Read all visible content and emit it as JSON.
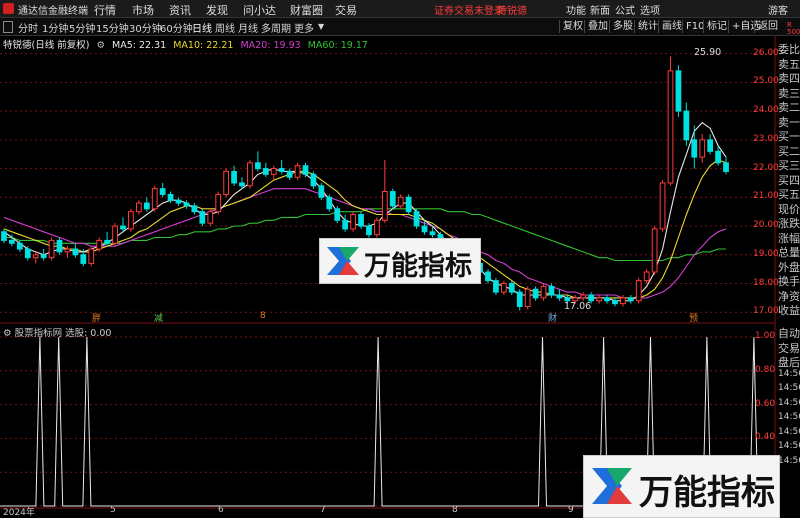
{
  "app": {
    "title": "通达信金融终端",
    "menus": [
      "行情",
      "市场",
      "资讯",
      "发现",
      "问小达",
      "财富圈",
      "交易"
    ],
    "login_status": "证券交易未登录",
    "user": "特锐德",
    "right_menus": [
      "功能",
      "新面",
      "公式",
      "选项"
    ],
    "guest": "游客"
  },
  "toolbar": {
    "periods": [
      "分时",
      "1分钟",
      "5分钟",
      "15分钟",
      "30分钟",
      "60分钟",
      "日线",
      "周线",
      "月线",
      "多周期",
      "更多"
    ],
    "active_period": "日线",
    "buttons": [
      "复权",
      "叠加",
      "多股",
      "统计",
      "画线",
      "F10",
      "标记",
      "+自选",
      "返回"
    ]
  },
  "chart_header": {
    "stock_name": "特锐德(日线 前复权)",
    "ma": [
      {
        "label": "MA5: 22.31",
        "color": "#e8e8e8"
      },
      {
        "label": "MA10: 22.21",
        "color": "#e8d830"
      },
      {
        "label": "MA20: 19.93",
        "color": "#d040d0"
      },
      {
        "label": "MA60: 19.17",
        "color": "#30c030"
      }
    ]
  },
  "price_axis": {
    "ticks": [
      "26.00",
      "25.00",
      "24.00",
      "23.00",
      "22.00",
      "21.00",
      "20.00",
      "19.00",
      "18.00",
      "17.00"
    ],
    "high_label": "25.90",
    "low_label": "17.06",
    "top_label": "R\n500"
  },
  "sub_axis": {
    "ticks": [
      "1.00",
      "0.80",
      "0.60",
      "0.40",
      "0.20",
      "0.00"
    ]
  },
  "indicator": {
    "legend": "股票指标网  选股: 0.00"
  },
  "time_axis": {
    "labels": [
      "2024年",
      "5",
      "6",
      "7",
      "8",
      "9"
    ]
  },
  "markers": [
    {
      "text": "胖",
      "color": "#e07a20"
    },
    {
      "text": "减",
      "color": "#58c858"
    },
    {
      "text": "8",
      "color": "#e07a20"
    },
    {
      "text": "财",
      "color": "#7aa8e8"
    },
    {
      "text": "预",
      "color": "#e07a20"
    }
  ],
  "right_panel": {
    "labels": [
      "委比",
      "卖五",
      "卖四",
      "卖三",
      "卖二",
      "卖一",
      "买一",
      "买二",
      "买三",
      "买四",
      "买五",
      "现价",
      "涨跌",
      "涨幅",
      "总量",
      "外盘",
      "换手",
      "净资",
      "收益",
      "自动",
      "交易",
      "盘后",
      "14:56",
      "14:56",
      "14:56",
      "14:56",
      "14:56",
      "14:56",
      "14:56"
    ]
  },
  "watermark": {
    "text": "万能指标",
    "colors": {
      "blue": "#1e6fd9",
      "green": "#17a86b",
      "red": "#e23b3b"
    }
  },
  "colors": {
    "up": "#ff3b3b",
    "down": "#00e0e0",
    "grid": "#7a1010",
    "ma5": "#e8e8e8",
    "ma10": "#e8d830",
    "ma20": "#d040d0",
    "ma60": "#30c030",
    "indicator": "#e8e8e8"
  },
  "chart_data": {
    "type": "candlestick",
    "ylim": [
      16.8,
      26.3
    ],
    "candles_ohlc": [
      [
        19.8,
        19.9,
        19.4,
        19.5
      ],
      [
        19.5,
        19.7,
        19.3,
        19.4
      ],
      [
        19.4,
        19.5,
        19.1,
        19.2
      ],
      [
        19.2,
        19.3,
        18.8,
        18.9
      ],
      [
        18.9,
        19.1,
        18.7,
        19.0
      ],
      [
        19.0,
        19.2,
        18.8,
        18.9
      ],
      [
        18.9,
        19.6,
        18.8,
        19.5
      ],
      [
        19.5,
        19.6,
        19.0,
        19.1
      ],
      [
        19.1,
        19.3,
        18.9,
        19.2
      ],
      [
        19.2,
        19.4,
        18.9,
        19.0
      ],
      [
        19.0,
        19.2,
        18.6,
        18.7
      ],
      [
        18.7,
        19.3,
        18.6,
        19.2
      ],
      [
        19.2,
        19.6,
        19.1,
        19.5
      ],
      [
        19.5,
        19.8,
        19.3,
        19.4
      ],
      [
        19.4,
        20.1,
        19.3,
        20.0
      ],
      [
        20.0,
        20.3,
        19.8,
        19.9
      ],
      [
        19.9,
        20.6,
        19.8,
        20.5
      ],
      [
        20.5,
        20.9,
        20.4,
        20.8
      ],
      [
        20.8,
        21.0,
        20.5,
        20.6
      ],
      [
        20.6,
        21.4,
        20.5,
        21.3
      ],
      [
        21.3,
        21.5,
        21.0,
        21.1
      ],
      [
        21.1,
        21.2,
        20.8,
        20.9
      ],
      [
        20.9,
        21.0,
        20.7,
        20.8
      ],
      [
        20.8,
        20.9,
        20.6,
        20.7
      ],
      [
        20.7,
        20.8,
        20.4,
        20.5
      ],
      [
        20.5,
        20.6,
        20.0,
        20.1
      ],
      [
        20.1,
        20.6,
        20.0,
        20.5
      ],
      [
        20.5,
        21.2,
        20.4,
        21.1
      ],
      [
        21.1,
        22.0,
        21.0,
        21.9
      ],
      [
        21.9,
        22.1,
        21.4,
        21.5
      ],
      [
        21.5,
        21.7,
        21.3,
        21.4
      ],
      [
        21.4,
        22.3,
        21.3,
        22.2
      ],
      [
        22.2,
        22.6,
        21.9,
        22.0
      ],
      [
        22.0,
        22.2,
        21.7,
        21.8
      ],
      [
        21.8,
        22.1,
        21.6,
        22.0
      ],
      [
        22.0,
        22.3,
        21.8,
        21.9
      ],
      [
        21.9,
        22.0,
        21.6,
        21.7
      ],
      [
        21.7,
        22.2,
        21.6,
        22.1
      ],
      [
        22.1,
        22.2,
        21.7,
        21.8
      ],
      [
        21.8,
        21.9,
        21.3,
        21.4
      ],
      [
        21.4,
        21.5,
        20.9,
        21.0
      ],
      [
        21.0,
        21.1,
        20.5,
        20.6
      ],
      [
        20.6,
        20.7,
        20.1,
        20.2
      ],
      [
        20.2,
        20.4,
        19.8,
        19.9
      ],
      [
        19.9,
        20.5,
        19.8,
        20.4
      ],
      [
        20.4,
        20.5,
        19.9,
        20.0
      ],
      [
        20.0,
        20.1,
        19.6,
        19.7
      ],
      [
        19.7,
        20.3,
        19.6,
        20.2
      ],
      [
        20.2,
        22.3,
        20.1,
        21.2
      ],
      [
        21.2,
        21.3,
        20.6,
        20.7
      ],
      [
        20.7,
        21.1,
        20.6,
        21.0
      ],
      [
        21.0,
        21.1,
        20.4,
        20.5
      ],
      [
        20.5,
        20.6,
        19.9,
        20.0
      ],
      [
        20.0,
        20.2,
        19.7,
        19.8
      ],
      [
        19.8,
        20.0,
        19.6,
        19.7
      ],
      [
        19.7,
        19.8,
        19.2,
        19.3
      ],
      [
        19.3,
        19.5,
        19.0,
        19.1
      ],
      [
        19.1,
        19.4,
        18.9,
        19.3
      ],
      [
        19.3,
        19.4,
        18.9,
        19.0
      ],
      [
        19.0,
        19.1,
        18.6,
        18.7
      ],
      [
        18.7,
        18.8,
        18.3,
        18.4
      ],
      [
        18.4,
        18.5,
        18.0,
        18.1
      ],
      [
        18.1,
        18.2,
        17.6,
        17.7
      ],
      [
        17.7,
        18.1,
        17.6,
        18.0
      ],
      [
        18.0,
        18.1,
        17.6,
        17.7
      ],
      [
        17.7,
        17.8,
        17.06,
        17.2
      ],
      [
        17.2,
        17.9,
        17.1,
        17.8
      ],
      [
        17.8,
        17.9,
        17.4,
        17.5
      ],
      [
        17.5,
        18.0,
        17.4,
        17.9
      ],
      [
        17.9,
        18.0,
        17.5,
        17.6
      ],
      [
        17.6,
        17.8,
        17.4,
        17.5
      ],
      [
        17.5,
        17.6,
        17.3,
        17.4
      ],
      [
        17.4,
        17.6,
        17.3,
        17.5
      ],
      [
        17.5,
        17.7,
        17.4,
        17.6
      ],
      [
        17.6,
        17.7,
        17.3,
        17.4
      ],
      [
        17.4,
        17.6,
        17.3,
        17.5
      ],
      [
        17.5,
        17.6,
        17.3,
        17.4
      ],
      [
        17.4,
        17.5,
        17.2,
        17.3
      ],
      [
        17.3,
        17.6,
        17.2,
        17.5
      ],
      [
        17.5,
        17.6,
        17.3,
        17.4
      ],
      [
        17.4,
        18.2,
        17.3,
        18.1
      ],
      [
        18.1,
        18.5,
        18.0,
        18.4
      ],
      [
        18.4,
        20.0,
        18.3,
        19.9
      ],
      [
        19.9,
        21.6,
        19.8,
        21.5
      ],
      [
        21.5,
        25.9,
        21.4,
        25.4
      ],
      [
        25.4,
        25.6,
        23.8,
        24.0
      ],
      [
        24.0,
        24.3,
        22.8,
        23.0
      ],
      [
        23.0,
        23.5,
        22.0,
        22.4
      ],
      [
        22.4,
        23.2,
        22.2,
        23.0
      ],
      [
        23.0,
        23.2,
        22.5,
        22.6
      ],
      [
        22.6,
        22.8,
        22.1,
        22.2
      ],
      [
        22.2,
        22.4,
        21.8,
        21.9
      ]
    ],
    "ma5": [
      19.8,
      19.6,
      19.4,
      19.2,
      19.1,
      19.0,
      19.1,
      19.2,
      19.2,
      19.1,
      19.1,
      19.2,
      19.3,
      19.4,
      19.6,
      19.8,
      20.0,
      20.2,
      20.4,
      20.6,
      20.8,
      20.9,
      20.9,
      20.8,
      20.6,
      20.4,
      20.4,
      20.5,
      20.8,
      21.1,
      21.3,
      21.5,
      21.8,
      21.9,
      22.0,
      21.9,
      21.9,
      21.9,
      21.8,
      21.6,
      21.3,
      20.9,
      20.5,
      20.2,
      20.1,
      20.0,
      20.0,
      20.1,
      20.4,
      20.6,
      20.8,
      20.8,
      20.5,
      20.2,
      20.0,
      19.7,
      19.4,
      19.2,
      19.0,
      18.8,
      18.5,
      18.2,
      18.0,
      17.9,
      17.8,
      17.6,
      17.6,
      17.6,
      17.6,
      17.6,
      17.6,
      17.5,
      17.5,
      17.5,
      17.5,
      17.5,
      17.5,
      17.4,
      17.4,
      17.4,
      17.6,
      17.9,
      18.4,
      19.2,
      20.5,
      21.7,
      22.5,
      23.3,
      23.6,
      23.4,
      22.8,
      22.4
    ],
    "ma10": [
      19.9,
      19.8,
      19.7,
      19.6,
      19.5,
      19.4,
      19.3,
      19.3,
      19.2,
      19.2,
      19.1,
      19.1,
      19.2,
      19.3,
      19.4,
      19.5,
      19.6,
      19.8,
      19.9,
      20.1,
      20.3,
      20.5,
      20.6,
      20.7,
      20.7,
      20.6,
      20.6,
      20.6,
      20.7,
      20.8,
      20.9,
      21.0,
      21.2,
      21.4,
      21.6,
      21.7,
      21.8,
      21.9,
      21.9,
      21.8,
      21.6,
      21.4,
      21.2,
      20.9,
      20.7,
      20.6,
      20.5,
      20.4,
      20.4,
      20.4,
      20.4,
      20.4,
      20.3,
      20.2,
      20.1,
      19.9,
      19.7,
      19.5,
      19.3,
      19.1,
      18.9,
      18.7,
      18.5,
      18.3,
      18.1,
      17.9,
      17.8,
      17.7,
      17.7,
      17.6,
      17.6,
      17.6,
      17.5,
      17.5,
      17.5,
      17.5,
      17.5,
      17.5,
      17.5,
      17.5,
      17.5,
      17.6,
      17.8,
      18.2,
      18.8,
      19.6,
      20.4,
      21.1,
      21.7,
      22.1,
      22.3,
      22.2
    ],
    "ma20": [
      20.3,
      20.2,
      20.1,
      20.0,
      19.9,
      19.8,
      19.7,
      19.6,
      19.5,
      19.4,
      19.4,
      19.3,
      19.3,
      19.3,
      19.3,
      19.4,
      19.5,
      19.6,
      19.7,
      19.8,
      19.9,
      20.0,
      20.1,
      20.2,
      20.3,
      20.4,
      20.5,
      20.6,
      20.7,
      20.8,
      20.9,
      21.0,
      21.1,
      21.2,
      21.3,
      21.3,
      21.3,
      21.3,
      21.3,
      21.2,
      21.1,
      21.0,
      20.9,
      20.8,
      20.7,
      20.6,
      20.6,
      20.5,
      20.5,
      20.4,
      20.4,
      20.3,
      20.2,
      20.1,
      20.0,
      19.9,
      19.7,
      19.6,
      19.4,
      19.3,
      19.1,
      19.0,
      18.8,
      18.7,
      18.5,
      18.4,
      18.2,
      18.1,
      18.0,
      17.9,
      17.8,
      17.7,
      17.7,
      17.6,
      17.6,
      17.6,
      17.6,
      17.6,
      17.5,
      17.5,
      17.5,
      17.5,
      17.6,
      17.7,
      17.9,
      18.2,
      18.6,
      19.0,
      19.3,
      19.6,
      19.8,
      19.9
    ],
    "ma60": [
      19.6,
      19.6,
      19.5,
      19.5,
      19.5,
      19.5,
      19.4,
      19.4,
      19.4,
      19.4,
      19.4,
      19.4,
      19.4,
      19.4,
      19.4,
      19.4,
      19.5,
      19.5,
      19.5,
      19.6,
      19.6,
      19.6,
      19.7,
      19.7,
      19.8,
      19.8,
      19.8,
      19.9,
      19.9,
      20.0,
      20.0,
      20.1,
      20.1,
      20.2,
      20.2,
      20.3,
      20.3,
      20.3,
      20.4,
      20.4,
      20.4,
      20.4,
      20.5,
      20.5,
      20.5,
      20.5,
      20.6,
      20.6,
      20.6,
      20.6,
      20.6,
      20.6,
      20.6,
      20.6,
      20.6,
      20.6,
      20.5,
      20.5,
      20.5,
      20.4,
      20.4,
      20.3,
      20.2,
      20.1,
      20.0,
      19.9,
      19.8,
      19.7,
      19.6,
      19.5,
      19.4,
      19.3,
      19.2,
      19.1,
      19.0,
      18.9,
      18.9,
      18.8,
      18.8,
      18.8,
      18.8,
      18.8,
      18.8,
      18.8,
      18.9,
      18.9,
      19.0,
      19.0,
      19.1,
      19.1,
      19.2,
      19.2
    ],
    "signals": [
      8,
      12,
      18,
      80,
      115,
      128,
      138,
      150,
      160
    ],
    "signal_note": "signal index positions over 165 sessions"
  }
}
